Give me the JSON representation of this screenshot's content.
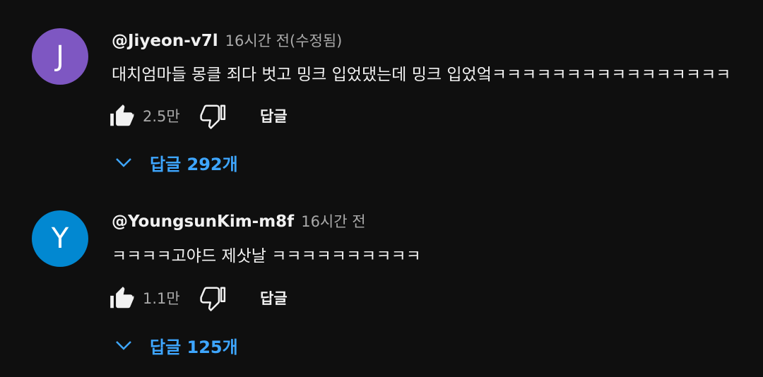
{
  "comments": [
    {
      "avatar_letter": "J",
      "avatar_color": "#7e57c2",
      "author": "@Jiyeon-v7l",
      "meta": "16시간 전(수정됨)",
      "text": "대치엄마들 몽클 죄다 벗고 밍크 입었댔는데 밍크 입었엌ㅋㅋㅋㅋㅋㅋㅋㅋㅋㅋㅋㅋㅋㅋㅋㅋ",
      "likes": "2.5만",
      "reply_label": "답글",
      "replies_label": "답글 292개"
    },
    {
      "avatar_letter": "Y",
      "avatar_color": "#0288d1",
      "author": "@YoungsunKim-m8f",
      "meta": "16시간 전",
      "text": "ㅋㅋㅋㅋ고야드 제삿날 ㅋㅋㅋㅋㅋㅋㅋㅋㅋㅋ",
      "likes": "1.1만",
      "reply_label": "답글",
      "replies_label": "답글 125개"
    }
  ],
  "icons": {
    "like": "thumb-up-icon",
    "dislike": "thumb-down-icon",
    "expand": "chevron-down-icon"
  }
}
